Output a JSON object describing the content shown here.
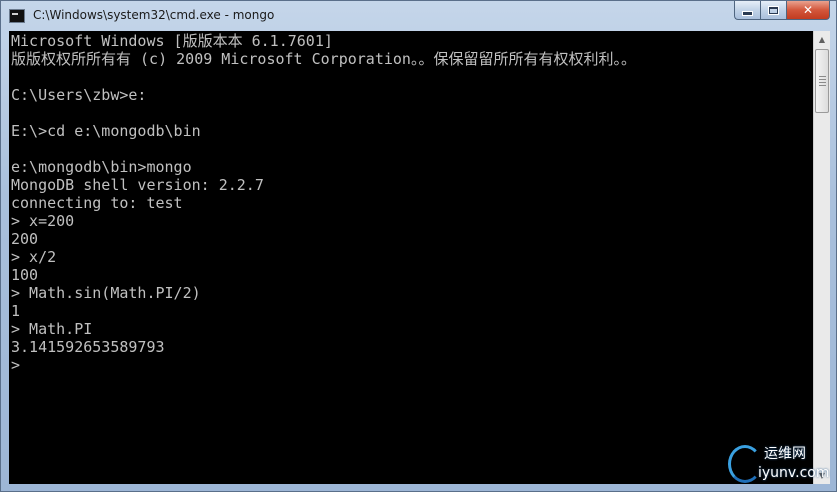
{
  "window": {
    "title": "C:\\Windows\\system32\\cmd.exe - mongo"
  },
  "caption_buttons": {
    "close_label": "✕"
  },
  "console": {
    "lines": [
      "Microsoft Windows [版版本本 6.1.7601]",
      "版版权权所所有有 (c) 2009 Microsoft Corporation。。保保留留所所有有权权利利。。",
      "",
      "C:\\Users\\zbw>e:",
      "",
      "E:\\>cd e:\\mongodb\\bin",
      "",
      "e:\\mongodb\\bin>mongo",
      "MongoDB shell version: 2.2.7",
      "connecting to: test",
      "> x=200",
      "200",
      "> x/2",
      "100",
      "> Math.sin(Math.PI/2)",
      "1",
      "> Math.PI",
      "3.141592653589793",
      "> "
    ]
  },
  "watermark": {
    "chinese": "运维网",
    "url": "iyunv.com"
  },
  "colors": {
    "console_bg": "#000000",
    "console_fg": "#c0c0c0",
    "close_button": "#c23b20"
  },
  "icons": {
    "app": "cmd-icon",
    "minimize": "minimize-icon",
    "maximize": "maximize-icon",
    "close": "close-icon",
    "scroll_up": "arrow-up-icon",
    "scroll_down": "arrow-down-icon"
  }
}
